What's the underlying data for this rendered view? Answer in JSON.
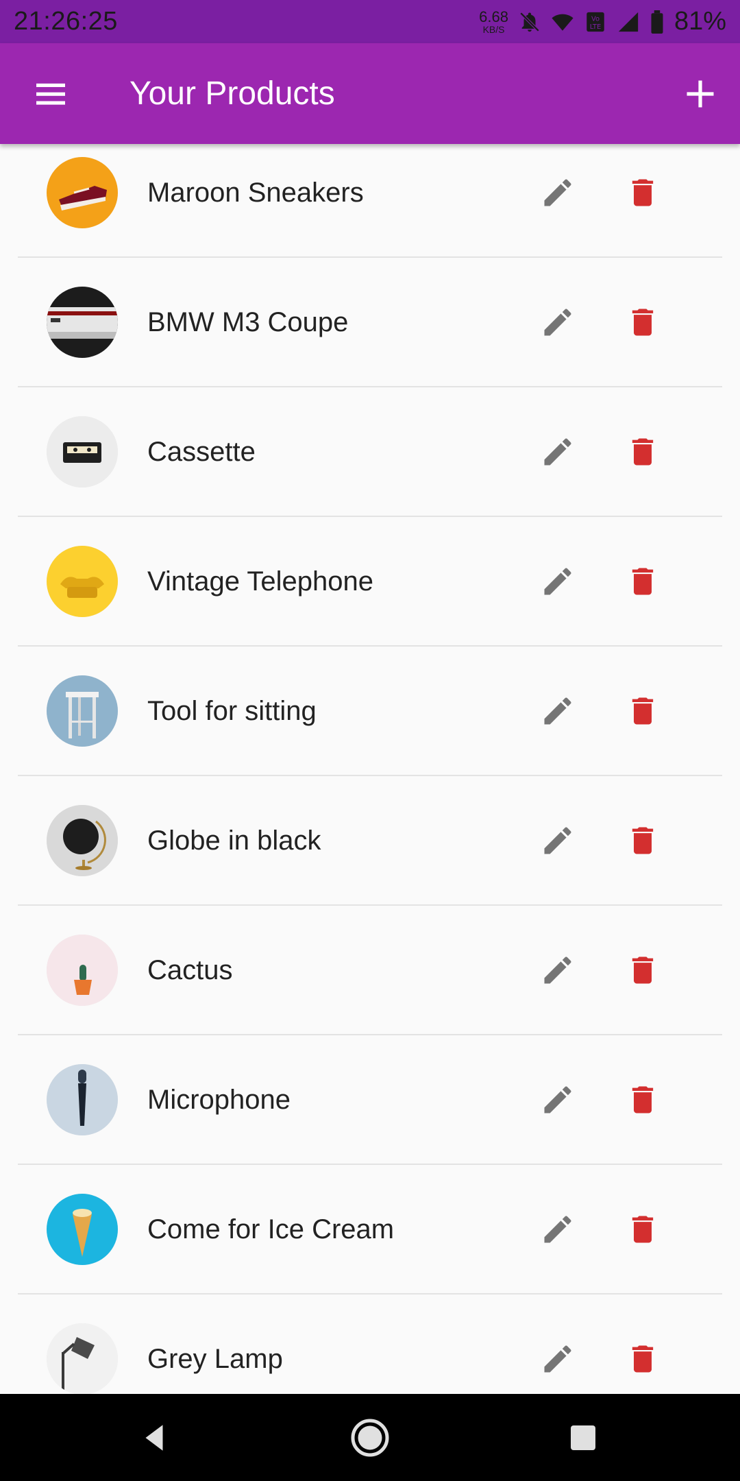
{
  "status_bar": {
    "time": "21:26:25",
    "net_speed_value": "6.68",
    "net_speed_unit": "KB/S",
    "battery": "81%",
    "icons": [
      "bell-off-icon",
      "wifi-icon",
      "volte-icon",
      "signal-icon",
      "battery-icon"
    ]
  },
  "app_bar": {
    "title": "Your Products",
    "menu_icon": "hamburger-menu-icon",
    "add_icon": "plus-icon",
    "color": "#9c27b0"
  },
  "products": [
    {
      "title": "Maroon Sneakers",
      "thumb_bg": "#f4a118"
    },
    {
      "title": "BMW M3 Coupe",
      "thumb_bg": "#1c1c1c"
    },
    {
      "title": "Cassette",
      "thumb_bg": "#ececec"
    },
    {
      "title": "Vintage Telephone",
      "thumb_bg": "#fcd02f"
    },
    {
      "title": "Tool for sitting",
      "thumb_bg": "#8fb3cc"
    },
    {
      "title": "Globe in black",
      "thumb_bg": "#d9d9d9"
    },
    {
      "title": "Cactus",
      "thumb_bg": "#f6e6ea"
    },
    {
      "title": "Microphone",
      "thumb_bg": "#c9d6e2"
    },
    {
      "title": "Come for Ice Cream",
      "thumb_bg": "#1cb5e0"
    },
    {
      "title": "Grey Lamp",
      "thumb_bg": "#f1f1f1"
    }
  ],
  "colors": {
    "edit_icon": "#757575",
    "delete_icon": "#d32f2f"
  },
  "nav_bar": {
    "icons": [
      "back-icon",
      "home-icon",
      "recents-icon"
    ]
  }
}
